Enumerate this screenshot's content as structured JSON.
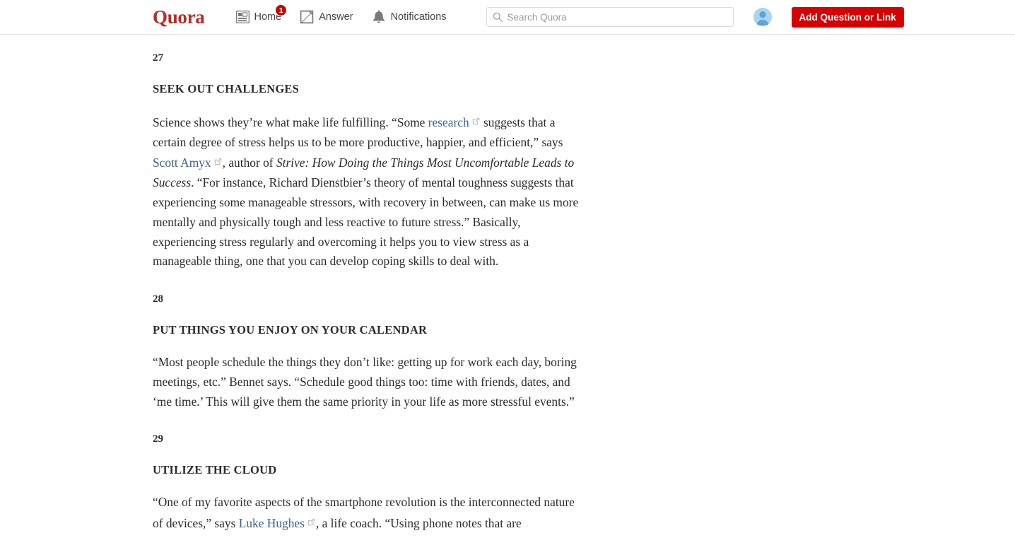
{
  "header": {
    "brand": "Quora",
    "nav": [
      {
        "label": "Home",
        "icon": "home-feed-icon",
        "badge": "1"
      },
      {
        "label": "Answer",
        "icon": "pencil-square-icon",
        "badge": null
      },
      {
        "label": "Notifications",
        "icon": "bell-icon",
        "badge": null
      }
    ],
    "search": {
      "placeholder": "Search Quora",
      "value": "",
      "icon": "search-icon"
    },
    "avatar_icon": "user-avatar-icon",
    "add_button": "Add Question or Link",
    "colors": {
      "brand_red": "#b92b27",
      "button_red": "#d60000",
      "badge_red": "#cc0000",
      "link_blue": "#3f5f91",
      "border_gray": "#e3e3e3"
    }
  },
  "article": {
    "sections": [
      {
        "number": "27",
        "heading": "SEEK OUT CHALLENGES",
        "body_parts": [
          {
            "type": "text",
            "text": "Science shows they’re what make life fulfilling. “Some "
          },
          {
            "type": "link",
            "text": "research"
          },
          {
            "type": "text",
            "text": " suggests that a certain degree of stress helps us to be more productive, happier, and efficient,” says "
          },
          {
            "type": "link",
            "text": "Scott Amyx"
          },
          {
            "type": "text",
            "text": ", author of "
          },
          {
            "type": "italic",
            "text": "Strive: How Doing the Things Most Uncomfortable Leads to Success"
          },
          {
            "type": "text",
            "text": ". “For instance, Richard Dienstbier’s theory of mental toughness suggests that experiencing some manageable stressors, with recovery in between, can make us more mentally and physically tough and less reactive to future stress.” Basically, experiencing stress regularly and overcoming it helps you to view stress as a manageable thing, one that you can develop coping skills to deal with."
          }
        ]
      },
      {
        "number": "28",
        "heading": "PUT THINGS YOU ENJOY ON YOUR CALENDAR",
        "body_parts": [
          {
            "type": "text",
            "text": "“Most people schedule the things they don’t like: getting up for work each day, boring meetings, etc.” Bennet says. “Schedule good things too: time with friends, dates, and ‘me time.’ This will give them the same priority in your life as more stressful events.”"
          }
        ]
      },
      {
        "number": "29",
        "heading": "UTILIZE THE CLOUD",
        "body_parts": [
          {
            "type": "text",
            "text": "“One of my favorite aspects of the smartphone revolution is the interconnected nature of devices,” says "
          },
          {
            "type": "link",
            "text": "Luke Hughes"
          },
          {
            "type": "text",
            "text": ", a life coach. “Using phone notes that are"
          }
        ]
      }
    ]
  }
}
